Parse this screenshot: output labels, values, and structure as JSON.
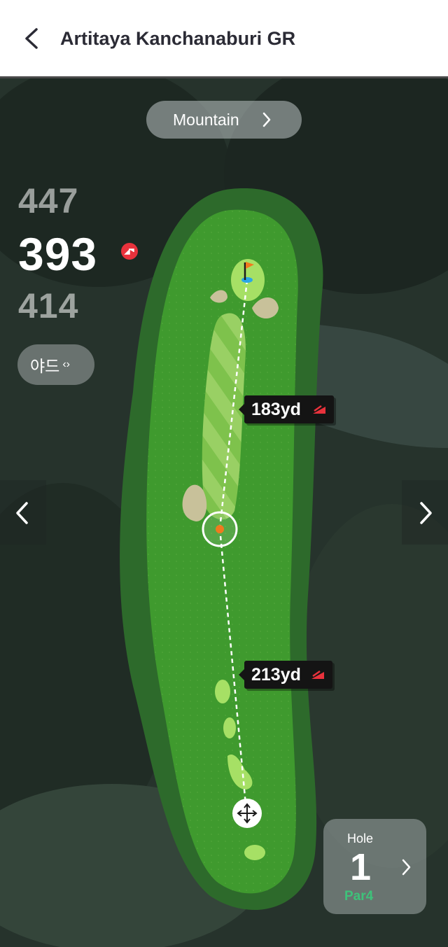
{
  "header": {
    "title": "Artitaya Kanchanaburi GR"
  },
  "course_selector": {
    "label": "Mountain"
  },
  "distances": {
    "back": "447",
    "current": "393",
    "front": "414"
  },
  "unit_toggle": {
    "label": "야드",
    "arrows": "‹›"
  },
  "hole_map": {
    "to_pin": {
      "label": "183yd"
    },
    "to_target": {
      "label": "213yd"
    }
  },
  "hole_card": {
    "label": "Hole",
    "number": "1",
    "par": "Par4"
  },
  "colors": {
    "green_light": "#7fca4a",
    "fairway": "#3d9a2c",
    "rough": "#2a6e26",
    "badge_red": "#e8323c",
    "par_green": "#3ec27a"
  }
}
